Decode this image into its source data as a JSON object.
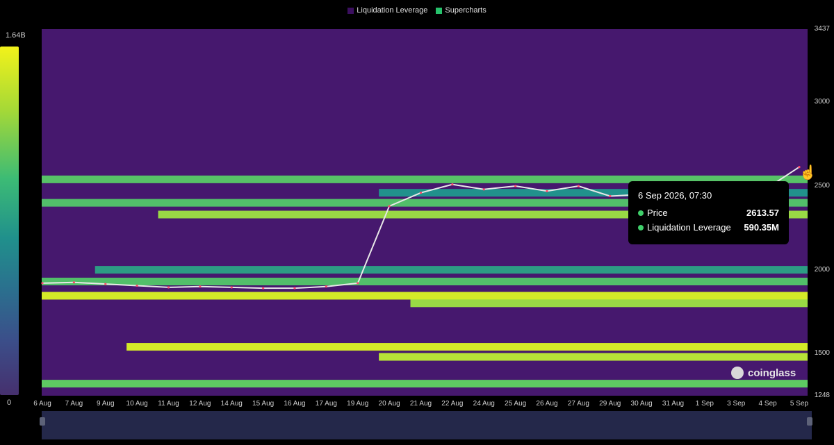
{
  "legend": [
    {
      "label": "Liquidation Leverage",
      "color": "#3b0f5f"
    },
    {
      "label": "Supercharts",
      "color": "#26c26b"
    }
  ],
  "colorbar": {
    "max_label": "1.64B",
    "min_label": "0"
  },
  "tooltip": {
    "date": "6 Sep 2026, 07:30",
    "rows": [
      {
        "label": "Price",
        "value": "2613.57"
      },
      {
        "label": "Liquidation Leverage",
        "value": "590.35M"
      }
    ]
  },
  "brand": "coinglass",
  "chart_data": {
    "type": "heatmap",
    "x_categories": [
      "6 Aug",
      "7 Aug",
      "9 Aug",
      "10 Aug",
      "11 Aug",
      "12 Aug",
      "14 Aug",
      "15 Aug",
      "16 Aug",
      "17 Aug",
      "19 Aug",
      "20 Aug",
      "21 Aug",
      "22 Aug",
      "24 Aug",
      "25 Aug",
      "26 Aug",
      "27 Aug",
      "29 Aug",
      "30 Aug",
      "31 Aug",
      "1 Sep",
      "3 Sep",
      "4 Sep",
      "5 Sep"
    ],
    "y_ticks": [
      1248,
      1500,
      2000,
      2500,
      3000,
      3437
    ],
    "ylim": [
      1248,
      3437
    ],
    "colorscale_range": [
      0,
      1640000000
    ],
    "price_series": {
      "name": "Supercharts",
      "x": [
        "6 Aug",
        "7 Aug",
        "9 Aug",
        "10 Aug",
        "11 Aug",
        "12 Aug",
        "14 Aug",
        "15 Aug",
        "16 Aug",
        "17 Aug",
        "19 Aug",
        "20 Aug",
        "21 Aug",
        "22 Aug",
        "24 Aug",
        "25 Aug",
        "26 Aug",
        "27 Aug",
        "29 Aug",
        "30 Aug",
        "31 Aug",
        "1 Sep",
        "3 Sep",
        "4 Sep",
        "5 Sep"
      ],
      "values": [
        1920,
        1925,
        1915,
        1905,
        1895,
        1900,
        1895,
        1890,
        1890,
        1900,
        1920,
        2380,
        2460,
        2510,
        2480,
        2500,
        2470,
        2500,
        2440,
        2450,
        2460,
        2470,
        2480,
        2490,
        2613.57
      ]
    },
    "liquidation_bands": [
      {
        "price": 2540,
        "intensity": 0.72,
        "start": "6 Aug"
      },
      {
        "price": 2460,
        "intensity": 0.5,
        "start": "20 Aug"
      },
      {
        "price": 2400,
        "intensity": 0.7,
        "start": "6 Aug"
      },
      {
        "price": 2330,
        "intensity": 0.85,
        "start": "11 Aug"
      },
      {
        "price": 2000,
        "intensity": 0.55,
        "start": "9 Aug"
      },
      {
        "price": 1930,
        "intensity": 0.7,
        "start": "6 Aug"
      },
      {
        "price": 1845,
        "intensity": 0.95,
        "start": "6 Aug"
      },
      {
        "price": 1800,
        "intensity": 0.85,
        "start": "21 Aug"
      },
      {
        "price": 1540,
        "intensity": 0.95,
        "start": "10 Aug"
      },
      {
        "price": 1480,
        "intensity": 0.9,
        "start": "20 Aug"
      },
      {
        "price": 1320,
        "intensity": 0.75,
        "start": "6 Aug"
      }
    ]
  }
}
